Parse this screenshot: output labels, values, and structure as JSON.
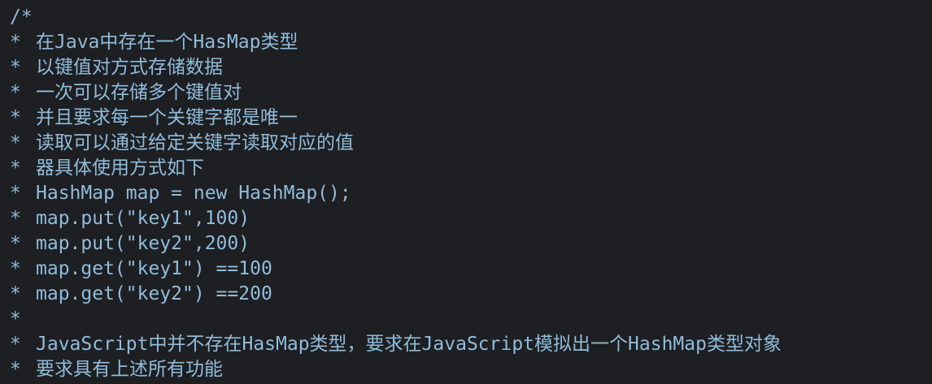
{
  "editor": {
    "colors": {
      "background": "#1e1f22",
      "comment": "#8fbcdb"
    },
    "lines": [
      {
        "marker": "/*",
        "text": ""
      },
      {
        "marker": "*",
        "text": "在Java中存在一个HasMap类型"
      },
      {
        "marker": "*",
        "text": "以键值对方式存储数据"
      },
      {
        "marker": "*",
        "text": "一次可以存储多个键值对"
      },
      {
        "marker": "*",
        "text": "并且要求每一个关键字都是唯一"
      },
      {
        "marker": "*",
        "text": "读取可以通过给定关键字读取对应的值"
      },
      {
        "marker": "*",
        "text": "器具体使用方式如下"
      },
      {
        "marker": "*",
        "text": "HashMap map = new HashMap();"
      },
      {
        "marker": "*",
        "text": "map.put(\"key1\",100)"
      },
      {
        "marker": "*",
        "text": "map.put(\"key2\",200)"
      },
      {
        "marker": "*",
        "text": "map.get(\"key1\") ==100"
      },
      {
        "marker": "*",
        "text": "map.get(\"key2\") ==200"
      },
      {
        "marker": "*",
        "text": ""
      },
      {
        "marker": "*",
        "text": "JavaScript中并不存在HasMap类型，要求在JavaScript模拟出一个HashMap类型对象"
      },
      {
        "marker": "*",
        "text": "要求具有上述所有功能"
      }
    ]
  }
}
